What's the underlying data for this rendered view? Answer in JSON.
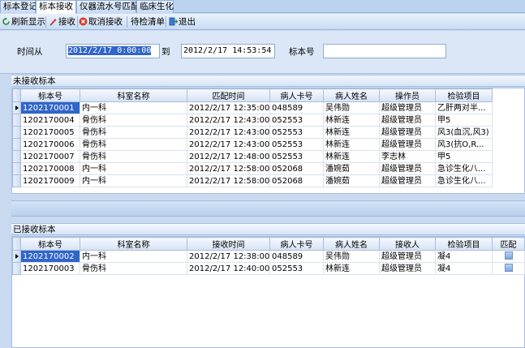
{
  "tabs": [
    {
      "label": "标本登记",
      "active": false
    },
    {
      "label": "标本接收",
      "active": true
    },
    {
      "label": "仪器流水号匹配",
      "active": false
    },
    {
      "label": "临床生化",
      "active": false
    }
  ],
  "toolbar": {
    "refresh_label": "刷新显示",
    "receive_label": "接收",
    "cancel_label": "取消接收",
    "pending_label": "待检清单",
    "exit_label": "退出"
  },
  "criteria": {
    "time_from_label": "时间从",
    "time_from_value": "2012/2/17 0:00:00",
    "to_label": "到",
    "time_to_value": "2012/2/17 14:53:54",
    "specimen_no_label": "标本号",
    "specimen_no_value": ""
  },
  "unreceived": {
    "title": "未接收标本",
    "columns": [
      "标本号",
      "科室名称",
      "匹配时间",
      "病人卡号",
      "病人姓名",
      "操作员",
      "检验项目"
    ],
    "rows": [
      [
        "1202170001",
        "内一科",
        "2012/2/17 12:35:00",
        "048589",
        "吴伟勋",
        "超级管理员",
        "乙肝两对半..."
      ],
      [
        "1202170004",
        "骨伤科",
        "2012/2/17 12:43:00",
        "052553",
        "林新连",
        "超级管理员",
        "甲5"
      ],
      [
        "1202170005",
        "骨伤科",
        "2012/2/17 12:43:00",
        "052553",
        "林新连",
        "超级管理员",
        "风3(血沉,风3)"
      ],
      [
        "1202170006",
        "骨伤科",
        "2012/2/17 12:43:00",
        "052553",
        "林新连",
        "超级管理员",
        "风3(抗O,R..."
      ],
      [
        "1202170007",
        "骨伤科",
        "2012/2/17 12:48:00",
        "052553",
        "林新连",
        "李志林",
        "甲5"
      ],
      [
        "1202170008",
        "内一科",
        "2012/2/17 12:58:00",
        "052068",
        "潘婉茹",
        "超级管理员",
        "急诊生化八..."
      ],
      [
        "1202170009",
        "内一科",
        "2012/2/17 12:58:00",
        "052068",
        "潘婉茹",
        "超级管理员",
        "急诊生化八..."
      ]
    ]
  },
  "received": {
    "title": "已接收标本",
    "columns": [
      "标本号",
      "科室名称",
      "接收时间",
      "病人卡号",
      "病人姓名",
      "接收人",
      "检验项目",
      "匹配"
    ],
    "rows": [
      [
        "1202170002",
        "内一科",
        "2012/2/17 12:38:00",
        "048589",
        "吴伟勋",
        "超级管理员",
        "凝4"
      ],
      [
        "1202170003",
        "骨伤科",
        "2012/2/17 12:40:00",
        "052553",
        "林新连",
        "超级管理员",
        "凝4"
      ]
    ]
  },
  "colors": {
    "selection": "#3165c8",
    "panel": "#dbe7f7",
    "header": "#d5e2f4"
  }
}
